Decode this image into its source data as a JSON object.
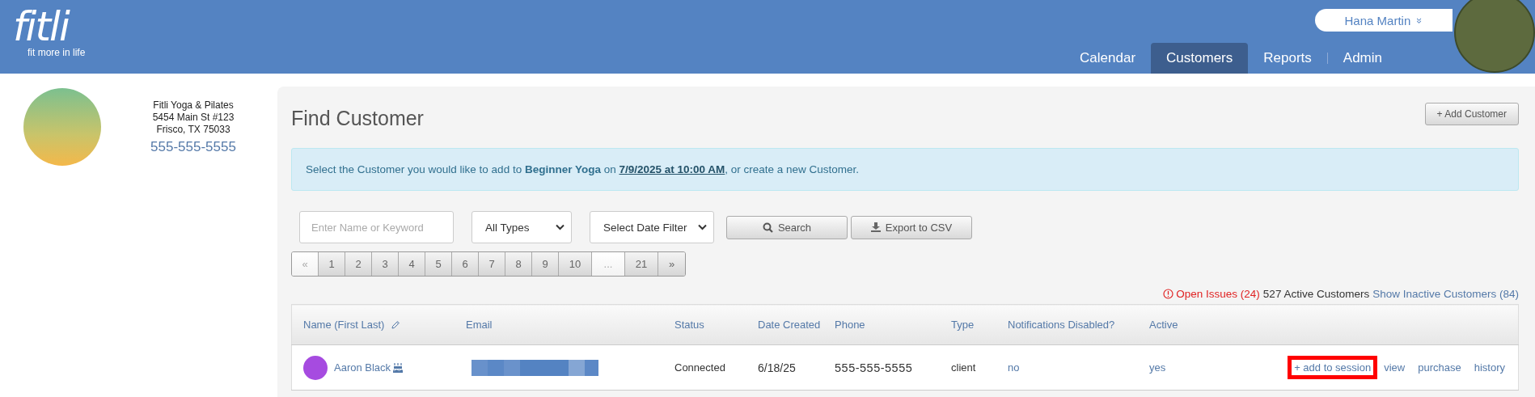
{
  "brand": {
    "logo": "fitli",
    "tagline": "fit more in life"
  },
  "user_menu": {
    "name": "Hana Martin",
    "caret": "»"
  },
  "nav": [
    {
      "label": "Calendar",
      "selected": false
    },
    {
      "label": "Customers",
      "selected": true
    },
    {
      "label": "Reports",
      "selected": false
    },
    {
      "label": "Admin",
      "selected": false
    }
  ],
  "business": {
    "name": "Fitli Yoga & Pilates",
    "address_line_1": "5454 Main St #123",
    "address_line_2": "Frisco, TX 75033",
    "phone": "555-555-5555"
  },
  "page": {
    "title": "Find Customer",
    "add_button": "+ Add Customer"
  },
  "alert": {
    "before": "Select the Customer you would like to add to ",
    "class_name": "Beginner Yoga",
    "middle": " on ",
    "date_link": "7/9/2025 at 10:00 AM",
    "after": ", or create a new Customer."
  },
  "filters": {
    "search": {
      "placeholder": "Enter Name or Keyword"
    },
    "type_select": "All Types",
    "date_select": "Select Date Filter",
    "search_button": "Search",
    "export_button": "Export to CSV"
  },
  "pagination": [
    {
      "label": "«",
      "disabled": true
    },
    {
      "label": "1",
      "disabled": false
    },
    {
      "label": "2",
      "disabled": false
    },
    {
      "label": "3",
      "disabled": false
    },
    {
      "label": "4",
      "disabled": false
    },
    {
      "label": "5",
      "disabled": false
    },
    {
      "label": "6",
      "disabled": false
    },
    {
      "label": "7",
      "disabled": false
    },
    {
      "label": "8",
      "disabled": false
    },
    {
      "label": "9",
      "disabled": false
    },
    {
      "label": "10",
      "disabled": false
    },
    {
      "label": "...",
      "disabled": true
    },
    {
      "label": "21",
      "disabled": false
    },
    {
      "label": "»",
      "disabled": false
    }
  ],
  "summary": {
    "open_issues": "Open Issues (24)",
    "active_count": "527 Active Customers",
    "inactive_link": "Show Inactive Customers (84)"
  },
  "table": {
    "columns": [
      "Name (First Last)",
      "Email",
      "Status",
      "Date Created",
      "Phone",
      "Type",
      "Notifications Disabled?",
      "Active"
    ],
    "rows": [
      {
        "name": "Aaron Black",
        "status": "Connected",
        "date_created": "6/18/25",
        "phone": "555-555-5555",
        "type": "client",
        "notifications_disabled": "no",
        "active": "yes",
        "actions": [
          {
            "label": "+ add to session",
            "highlighted": true
          },
          {
            "label": "view",
            "highlighted": false
          },
          {
            "label": "purchase",
            "highlighted": false
          },
          {
            "label": "history",
            "highlighted": false
          }
        ]
      }
    ]
  }
}
